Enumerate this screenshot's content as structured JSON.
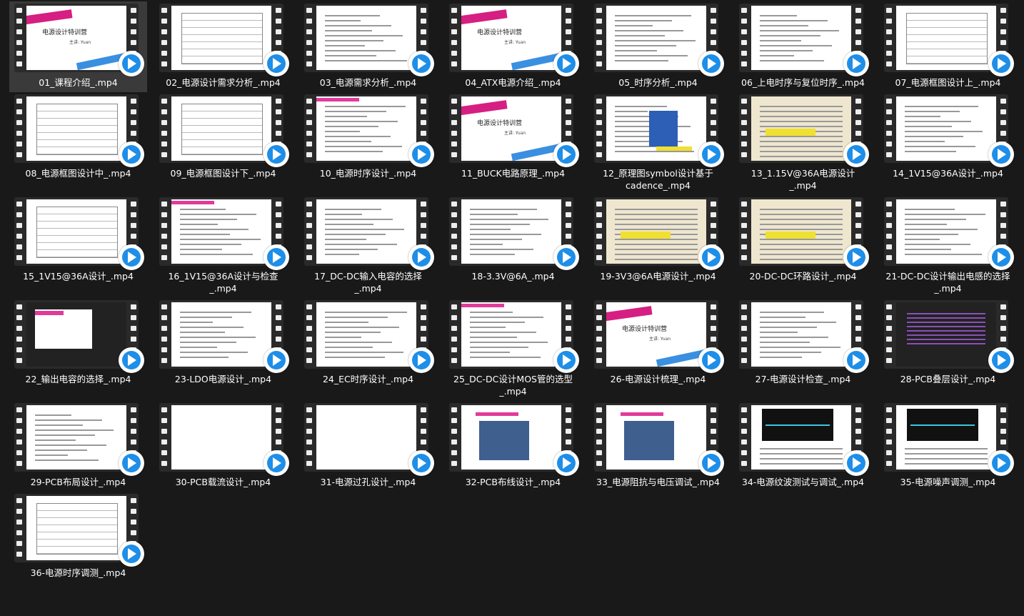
{
  "colors": {
    "background": "#191919",
    "selected": "#3a3a3a",
    "play_badge": "#1e8ee8"
  },
  "icons": {
    "play": "play-badge-icon",
    "film": "film-strip-icon"
  },
  "files": [
    {
      "name": "01_课程介绍_.mp4",
      "thumb": "slide"
    },
    {
      "name": "02_电源设计需求分析_.mp4",
      "thumb": "table"
    },
    {
      "name": "03_电源需求分析_.mp4",
      "thumb": "lines"
    },
    {
      "name": "04_ATX电源介绍_.mp4",
      "thumb": "slide"
    },
    {
      "name": "05_时序分析_.mp4",
      "thumb": "lines"
    },
    {
      "name": "06_上电时序与复位时序_.mp4",
      "thumb": "lines"
    },
    {
      "name": "07_电源框图设计上_.mp4",
      "thumb": "table"
    },
    {
      "name": "08_电源框图设计中_.mp4",
      "thumb": "table"
    },
    {
      "name": "09_电源框图设计下_.mp4",
      "thumb": "table"
    },
    {
      "name": "10_电源时序设计_.mp4",
      "thumb": "lines"
    },
    {
      "name": "11_BUCK电路原理_.mp4",
      "thumb": "slide"
    },
    {
      "name": "12_原理图symbol设计基于cadence_.mp4",
      "thumb": "schem"
    },
    {
      "name": "13_1.15V@36A电源设计_.mp4",
      "thumb": "paper"
    },
    {
      "name": "14_1V15@36A设计_.mp4",
      "thumb": "lines"
    },
    {
      "name": "15_1V15@36A设计_.mp4",
      "thumb": "table"
    },
    {
      "name": "16_1V15@36A设计与检查_.mp4",
      "thumb": "lines"
    },
    {
      "name": "17_DC-DC输入电容的选择_.mp4",
      "thumb": "lines"
    },
    {
      "name": "18-3.3V@6A_.mp4",
      "thumb": "lines"
    },
    {
      "name": "19-3V3@6A电源设计_.mp4",
      "thumb": "paper"
    },
    {
      "name": "20-DC-DC环路设计_.mp4",
      "thumb": "paper"
    },
    {
      "name": "21-DC-DC设计输出电感的选择_.mp4",
      "thumb": "lines"
    },
    {
      "name": "22_输出电容的选择_.mp4",
      "thumb": "video"
    },
    {
      "name": "23-LDO电源设计_.mp4",
      "thumb": "lines"
    },
    {
      "name": "24_EC时序设计_.mp4",
      "thumb": "lines"
    },
    {
      "name": "25_DC-DC设计MOS管的选型_.mp4",
      "thumb": "lines"
    },
    {
      "name": "26-电源设计梳理_.mp4",
      "thumb": "slide"
    },
    {
      "name": "27-电源设计检查_.mp4",
      "thumb": "lines"
    },
    {
      "name": "28-PCB叠层设计_.mp4",
      "thumb": "pcb"
    },
    {
      "name": "29-PCB布局设计_.mp4",
      "thumb": "lines"
    },
    {
      "name": "30-PCB载流设计_.mp4",
      "thumb": "blank"
    },
    {
      "name": "31-电源过孔设计_.mp4",
      "thumb": "blank"
    },
    {
      "name": "32-PCB布线设计_.mp4",
      "thumb": "image"
    },
    {
      "name": "33_电源阻抗与电压调试_.mp4",
      "thumb": "image"
    },
    {
      "name": "34-电源纹波测试与调试_.mp4",
      "thumb": "scope"
    },
    {
      "name": "35-电源噪声调测_.mp4",
      "thumb": "scope"
    },
    {
      "name": "36-电源时序调测_.mp4",
      "thumb": "table"
    }
  ],
  "slide_text": {
    "title": "电源设计特训营",
    "sub": "主讲: Yuan"
  }
}
